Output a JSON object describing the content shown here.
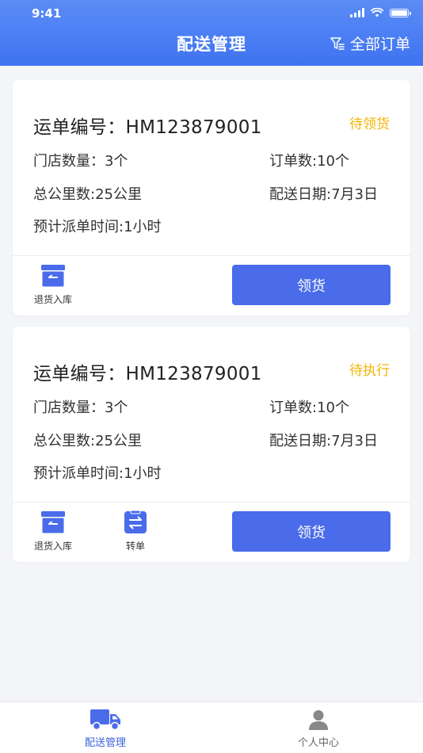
{
  "status_bar": {
    "time": "9:41"
  },
  "nav": {
    "title": "配送管理",
    "filter_label": "全部订单"
  },
  "orders": [
    {
      "title": "运单编号：HM123879001",
      "status": "待领货",
      "store_count": "门店数量：3个",
      "order_count": "订单数:10个",
      "total_km": "总公里数:25公里",
      "delivery_date": "配送日期:7月3日",
      "dispatch_time": "预计派单时间:1小时",
      "actions": [
        "退货入库"
      ],
      "button": "领货"
    },
    {
      "title": "运单编号：HM123879001",
      "status": "待执行",
      "store_count": "门店数量：3个",
      "order_count": "订单数:10个",
      "total_km": "总公里数:25公里",
      "delivery_date": "配送日期:7月3日",
      "dispatch_time": "预计派单时间:1小时",
      "actions": [
        "退货入库",
        "转单"
      ],
      "button": "领货"
    }
  ],
  "tabbar": {
    "items": [
      {
        "label": "配送管理",
        "active": true
      },
      {
        "label": "个人中心",
        "active": false
      }
    ]
  },
  "colors": {
    "accent": "#3e63dd",
    "button": "#4a6cea",
    "status": "#f4b400",
    "header_top": "#5a8cf6",
    "header_bottom": "#3f73f0"
  },
  "icons": {
    "filter": "filter-icon",
    "return_stock": "archive-box-icon",
    "transfer": "transfer-order-icon",
    "delivery_tab": "truck-icon",
    "profile_tab": "person-icon"
  }
}
